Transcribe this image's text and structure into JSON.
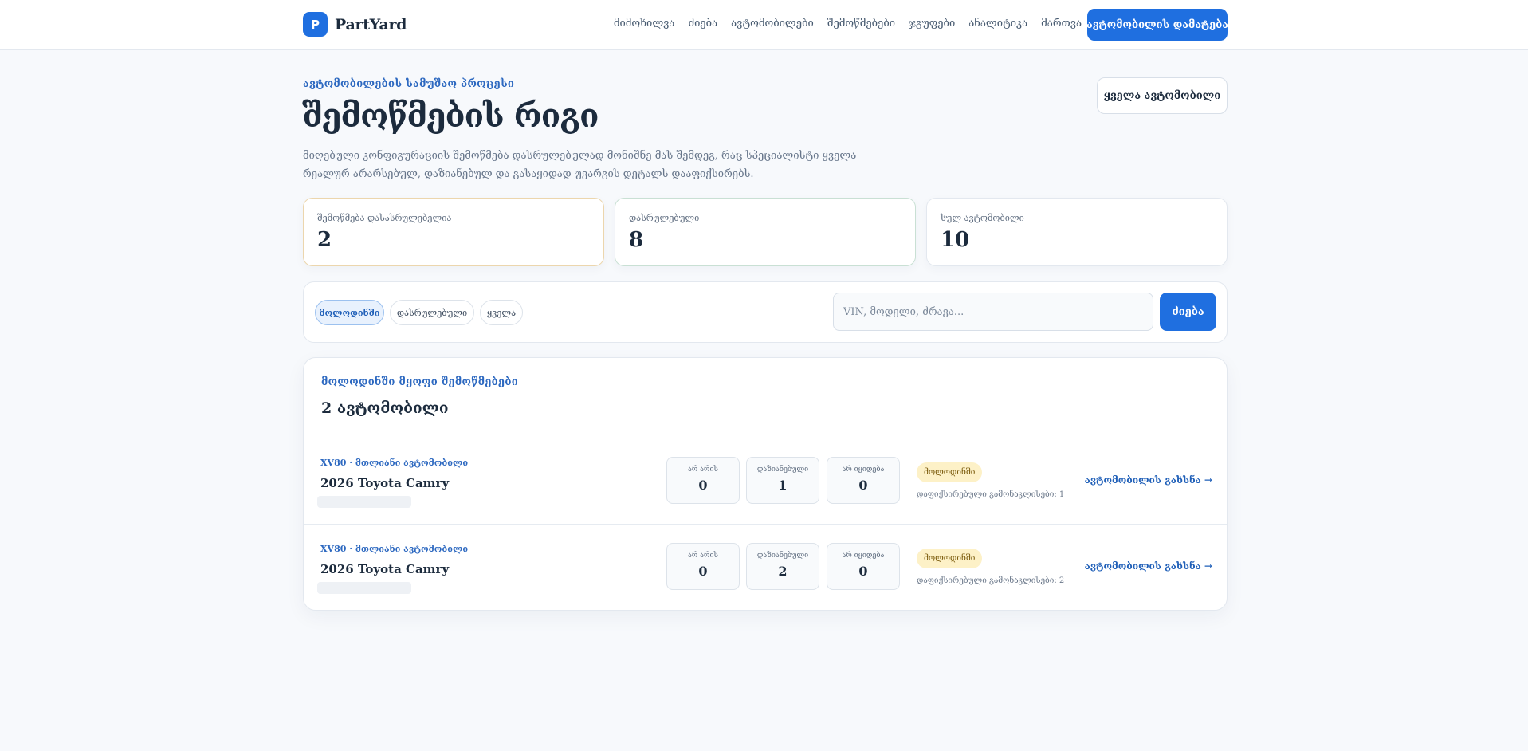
{
  "brand": {
    "logo_letter": "P",
    "name": "PartYard"
  },
  "nav": {
    "items": [
      "მიმოხილვა",
      "ძიება",
      "ავტომობილები",
      "შემოწმებები",
      "ჯგუფები",
      "ანალიტიკა",
      "მართვა"
    ]
  },
  "header": {
    "add_car_button": "ავტომობილის დამატება"
  },
  "page": {
    "eyebrow": "ავტომობილების სამუშაო პროცესი",
    "title": "შემოწმების რიგი",
    "description": "მიღებული კონფიგურაციის შემოწმება დასრულებულად მონიშნე მას შემდეგ, რაც სპეციალისტი ყველა რეალურ არარსებულ, დაზიანებულ და გასაყიდად უვარგის დეტალს დააფიქსირებს.",
    "all_cars_button": "ყველა ავტომობილი"
  },
  "stats": [
    {
      "label": "შემოწმება დასასრულებელია",
      "value": "2"
    },
    {
      "label": "დასრულებული",
      "value": "8"
    },
    {
      "label": "სულ ავტომობილი",
      "value": "10"
    }
  ],
  "filters": {
    "chips": [
      "მოლოდინში",
      "დასრულებული",
      "ყველა"
    ],
    "active": "მოლოდინში",
    "search_placeholder": "VIN, მოდელი, ძრავა...",
    "search_button": "ძიება"
  },
  "panel": {
    "eyebrow": "მოლოდინში მყოფი შემოწმებები",
    "title": "2 ავტომობილი",
    "rows": [
      {
        "model": "XV80 · მთლიანი ავტომობილი",
        "car": "2026 Toyota Camry",
        "counters": [
          {
            "label": "არ არის",
            "value": "0"
          },
          {
            "label": "დაზიანებული",
            "value": "1"
          },
          {
            "label": "არ იყიდება",
            "value": "0"
          }
        ],
        "status": "მოლოდინში",
        "recorded": "დაფიქსირებული გამონაკლისები: 1",
        "open_link": "ავტომობილის გახსნა →"
      },
      {
        "model": "XV80 · მთლიანი ავტომობილი",
        "car": "2026 Toyota Camry",
        "counters": [
          {
            "label": "არ არის",
            "value": "0"
          },
          {
            "label": "დაზიანებული",
            "value": "2"
          },
          {
            "label": "არ იყიდება",
            "value": "0"
          }
        ],
        "status": "მოლოდინში",
        "recorded": "დაფიქსირებული გამონაკლისები: 2",
        "open_link": "ავტომობილის გახსნა →"
      }
    ]
  },
  "colors": {
    "accent": "#1f6fe0",
    "pending_badge_bg": "#fdf1c7",
    "pending_border": "#ecd6ad",
    "done_border": "#c9e0d4"
  }
}
